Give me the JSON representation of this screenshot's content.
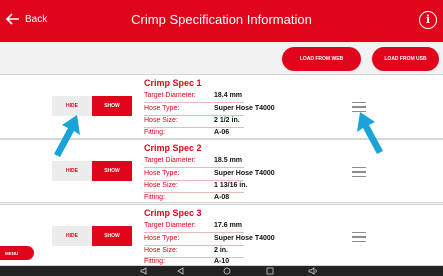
{
  "header": {
    "back_label": "Back",
    "title": "Crimp Specification Information"
  },
  "actions": {
    "load_web": "LOAD FROM WEB",
    "load_usb": "LOAD FROM USB"
  },
  "menu_label": "MENU",
  "specs": [
    {
      "title": "Crimp Spec 1",
      "hide": "HIDE",
      "show": "SHOW",
      "labels": {
        "target": "Target Diameter:",
        "type": "Hose Type:",
        "size": "Hose Size:",
        "fitting": "Fitting:"
      },
      "target_diameter": "18.4 mm",
      "hose_type": "Super Hose T4000",
      "hose_size": "2 1/2 in.",
      "fitting": "A-06"
    },
    {
      "title": "Crimp Spec 2",
      "hide": "HIDE",
      "show": "SHOW",
      "labels": {
        "target": "Target Diameter:",
        "type": "Hose Type:",
        "size": "Hose Size:",
        "fitting": "Fitting:"
      },
      "target_diameter": "18.5 mm",
      "hose_type": "Super Hose T4000",
      "hose_size": "1 13/16 in.",
      "fitting": "A-08"
    },
    {
      "title": "Crimp Spec 3",
      "hide": "HIDE",
      "show": "SHOW",
      "labels": {
        "target": "Target Diameter:",
        "type": "Hose Type:",
        "size": "Hose Size:",
        "fitting": "Fitting:"
      },
      "target_diameter": "17.6 mm",
      "hose_type": "Super Hose T4000",
      "hose_size": "2 in.",
      "fitting": "A-10"
    }
  ],
  "colors": {
    "brand_red": "#e0051b",
    "annotation_arrow": "#1aa3d6"
  }
}
